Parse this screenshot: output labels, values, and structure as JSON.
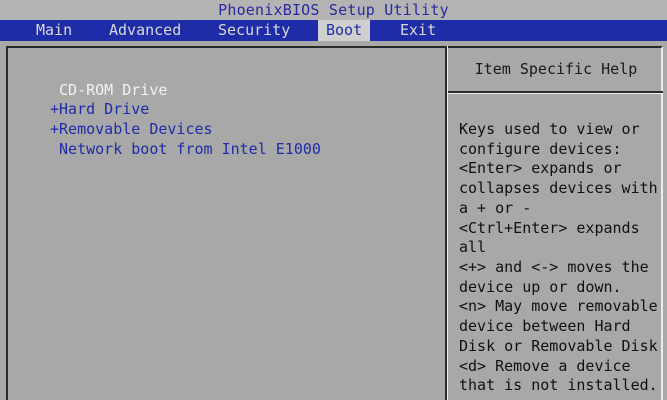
{
  "title": "PhoenixBIOS Setup Utility",
  "menu": [
    {
      "label": "Main"
    },
    {
      "label": "Advanced"
    },
    {
      "label": "Security"
    },
    {
      "label": "Boot"
    },
    {
      "label": "Exit"
    }
  ],
  "active_menu": "Boot",
  "boot_items": [
    {
      "label": " CD-ROM Drive",
      "selected": true
    },
    {
      "label": "+Hard Drive",
      "selected": false
    },
    {
      "label": "+Removable Devices",
      "selected": false
    },
    {
      "label": " Network boot from Intel E1000",
      "selected": false
    }
  ],
  "help": {
    "title": "Item Specific Help",
    "lines": [
      "Keys used to view or",
      "configure devices:",
      "<Enter> expands or",
      "collapses devices with",
      "a + or -",
      "<Ctrl+Enter> expands",
      "all",
      "<+> and <-> moves the",
      "device up or down.",
      "<n> May move removable",
      "device between Hard",
      "Disk or Removable Disk",
      "<d> Remove a device",
      "that is not installed."
    ]
  },
  "colors": {
    "menu_bar": "#1f2ca8",
    "background": "#a8a8a8",
    "selected_text": "#f2f2f2",
    "item_text": "#1f2ca8"
  }
}
